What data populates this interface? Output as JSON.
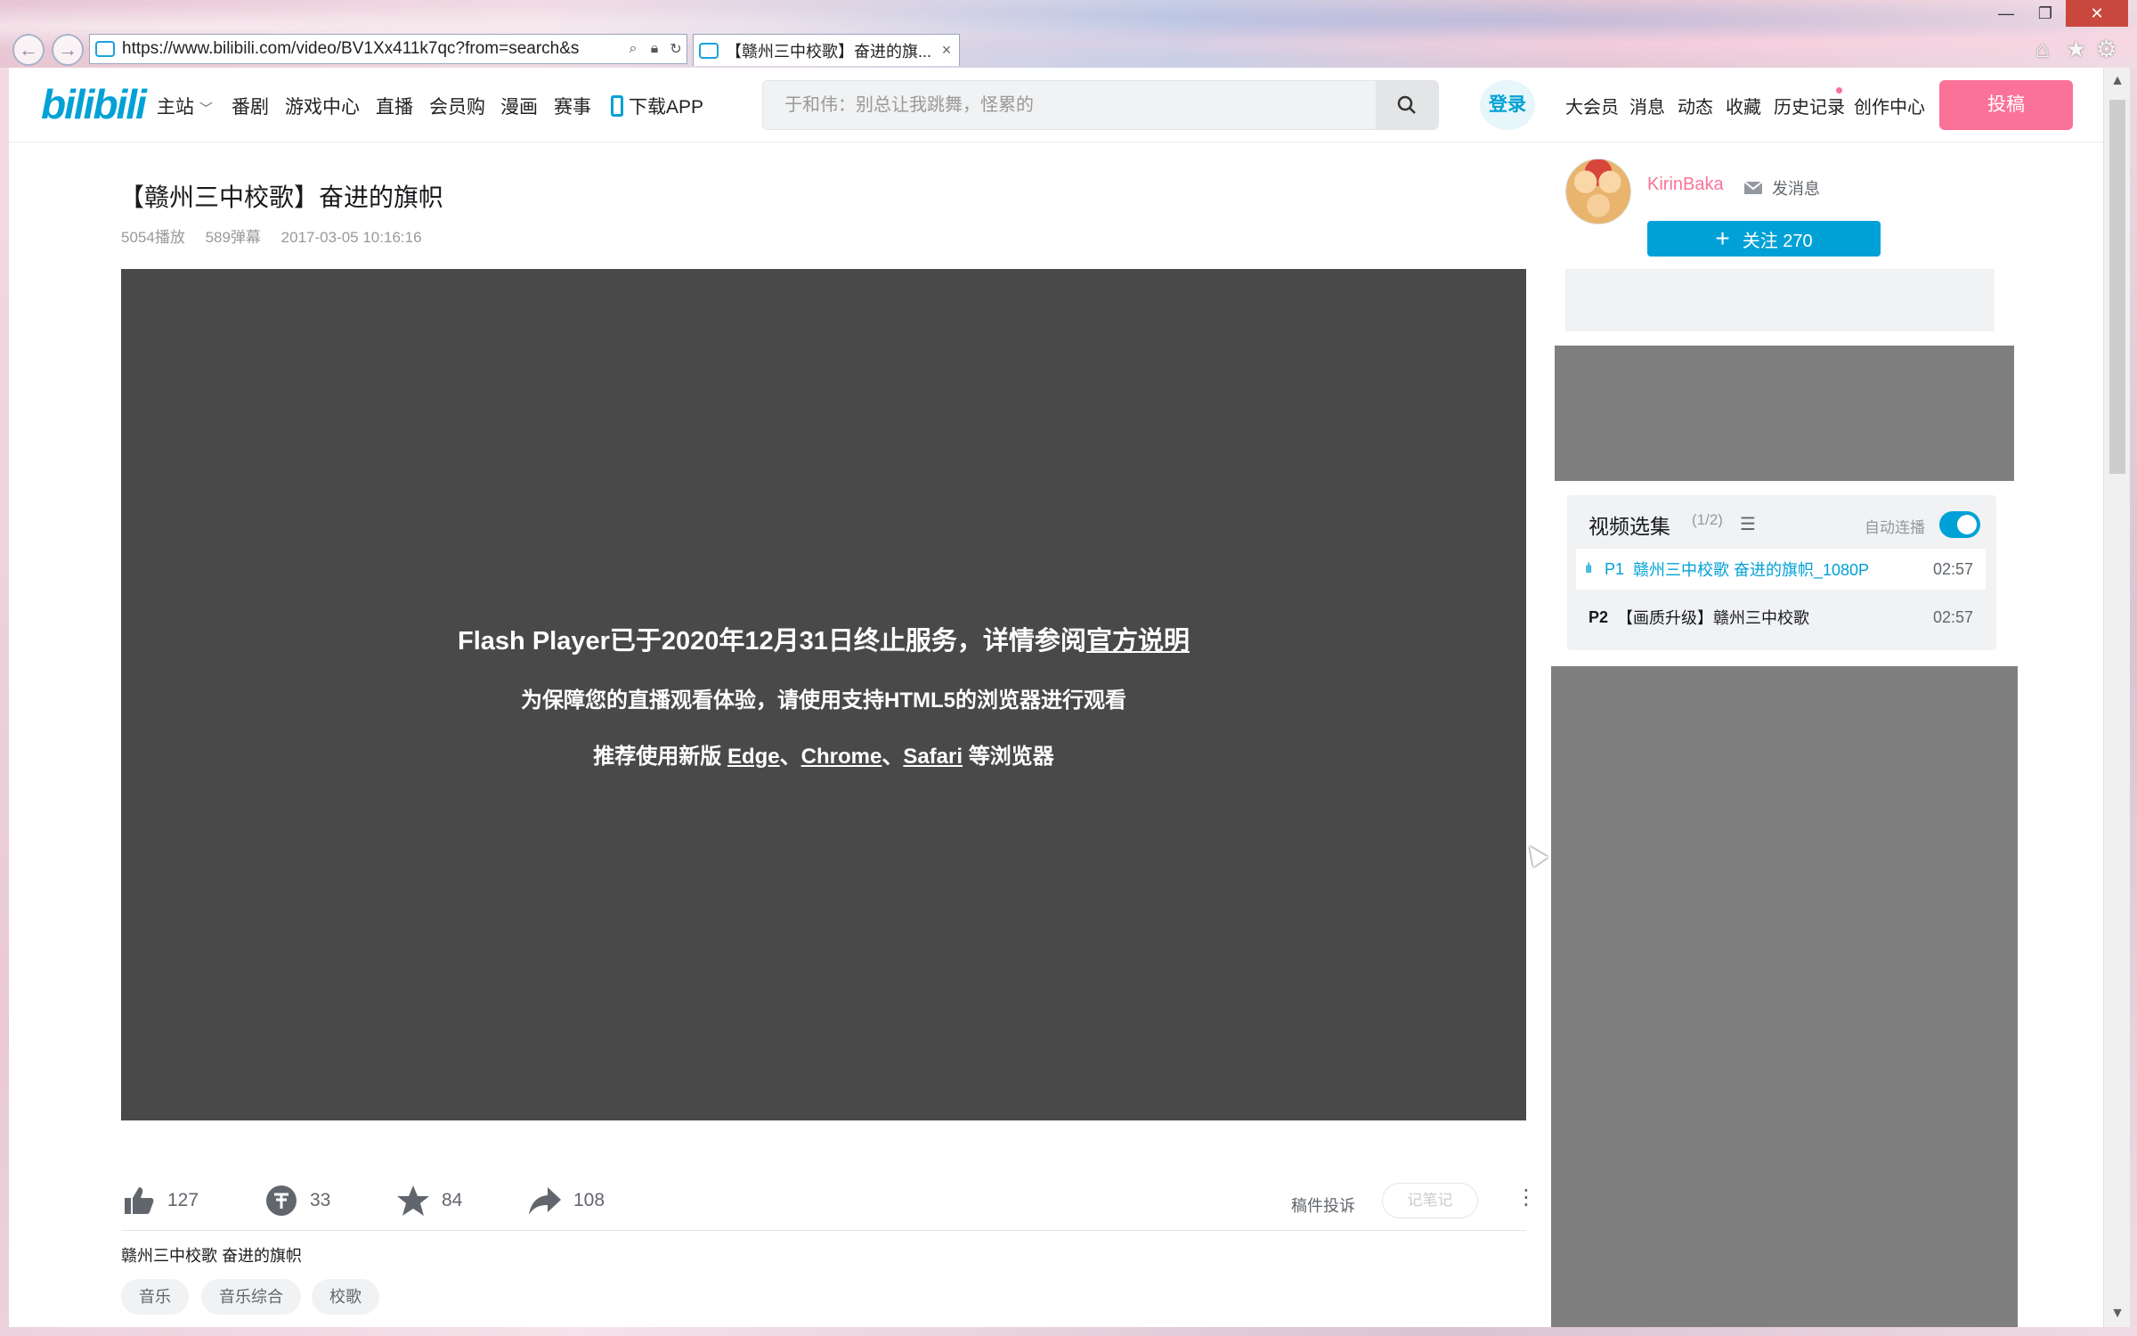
{
  "browser": {
    "url": "https://www.bilibili.com/video/BV1Xx411k7qc?from=search&s",
    "tab_title": "【赣州三中校歌】奋进的旗...",
    "tab_close": "×",
    "window_buttons": [
      "—",
      "❐",
      "✕"
    ],
    "toolbar_icons": [
      "home-icon",
      "star-icon",
      "gear-icon"
    ]
  },
  "header": {
    "logo": "bilibili",
    "nav": [
      "主站",
      "番剧",
      "游戏中心",
      "直播",
      "会员购",
      "漫画",
      "赛事",
      "下载APP"
    ],
    "search_placeholder": "于和伟：别总让我跳舞，怪累的",
    "login": "登录",
    "right_nav": [
      "大会员",
      "消息",
      "动态",
      "收藏",
      "历史记录",
      "创作中心"
    ],
    "upload": "投稿"
  },
  "video": {
    "title": "【赣州三中校歌】奋进的旗帜",
    "plays": "5054播放",
    "danmaku": "589弹幕",
    "date": "2017-03-05 10:16:16"
  },
  "player": {
    "line1_prefix": "Flash Player已于2020年12月31日终止服务，详情参阅",
    "line1_link": "官方说明",
    "line2": "为保障您的直播观看体验，请使用支持HTML5的浏览器进行观看",
    "line3_prefix": "推荐使用新版 ",
    "browser_edge": "Edge",
    "sep1": "、",
    "browser_chrome": "Chrome",
    "sep2": "、",
    "browser_safari": "Safari",
    "line3_suffix": " 等浏览器"
  },
  "actions": {
    "like": "127",
    "coin": "33",
    "favorite": "84",
    "share": "108",
    "report": "稿件投诉",
    "note": "记笔记",
    "more": "⋮"
  },
  "description": "赣州三中校歌 奋进的旗帜",
  "tags": [
    "音乐",
    "音乐综合",
    "校歌"
  ],
  "uploader": {
    "name": "KirinBaka",
    "message": "发消息",
    "follow": "关注 270"
  },
  "playlist": {
    "title": "视频选集",
    "count": "(1/2)",
    "autoplay_label": "自动连播",
    "autoplay_on": true,
    "items": [
      {
        "index": "P1",
        "name": "赣州三中校歌 奋进的旗帜_1080P",
        "duration": "02:57",
        "active": true
      },
      {
        "index": "P2",
        "name": "【画质升级】赣州三中校歌",
        "duration": "02:57",
        "active": false
      }
    ]
  },
  "colors": {
    "brand_blue": "#00a1d6",
    "brand_pink": "#fb7299",
    "player_bg": "#494949",
    "ad_gray": "#7f7f7f"
  }
}
